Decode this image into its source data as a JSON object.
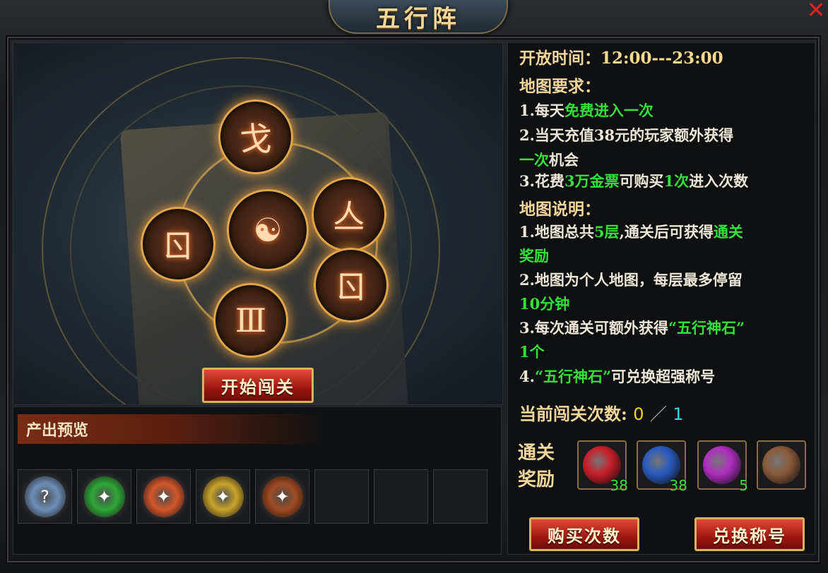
{
  "window": {
    "title": "五行阵",
    "close_symbol": "✕"
  },
  "scene": {
    "runes": [
      "戈",
      "亼",
      "ㄖ",
      "ㄖ",
      "Ⅲ"
    ],
    "center_symbol": "☯",
    "start_button": "开始闯关"
  },
  "preview": {
    "header": "产出预览",
    "items": [
      {
        "icon": "blue-gem-icon",
        "color": "#6f8fb8",
        "glyph": "?"
      },
      {
        "icon": "green-gem-icon",
        "color": "#2fa838",
        "glyph": "✦"
      },
      {
        "icon": "orange-gem-icon",
        "color": "#d3562a",
        "glyph": "✦"
      },
      {
        "icon": "gold-gem-icon",
        "color": "#c9a42a",
        "glyph": "✦"
      },
      {
        "icon": "bronze-gem-icon",
        "color": "#a24a22",
        "glyph": "✦"
      }
    ],
    "empty_slots": 3
  },
  "info": {
    "open_time_label": "开放时间：",
    "open_time_value": "12:00---23:00",
    "map_req_title": "地图要求：",
    "req1_a": "1.每天",
    "req1_b": "免费进入一次",
    "req2_a": "2.当天充值38元的玩家额外获得",
    "req2_b": "一次",
    "req2_c": "机会",
    "req3_a": "3.花费",
    "req3_b": "3万金票",
    "req3_c": "可购买",
    "req3_d": "1次",
    "req3_e": "进入次数",
    "map_desc_title": "地图说明：",
    "desc1_a": "1.地图总共",
    "desc1_b": "5层",
    "desc1_c": ",通关后可获得",
    "desc1_d": "通关",
    "desc1_e": "奖励",
    "desc2_a": "2.地图为个人地图，每层最多停留",
    "desc2_b": "10分钟",
    "desc3_a": "3.每次通关可额外获得",
    "desc3_b": "“五行神石”",
    "desc3_c": "1个",
    "desc4_a": "4.",
    "desc4_b": "“五行神石”",
    "desc4_c": "可兑换超强称号",
    "counter_label": "当前闯关次数:",
    "counter_used": "0",
    "counter_sep": "／",
    "counter_total": "1",
    "rewards_label": "通关奖励",
    "rewards": [
      {
        "icon": "red-orb-icon",
        "color": "#c81e2a",
        "count": "38"
      },
      {
        "icon": "blue-orb-icon",
        "color": "#2a5ac0",
        "count": "38"
      },
      {
        "icon": "purple-orb-icon",
        "color": "#b02ec0",
        "count": "5"
      },
      {
        "icon": "eye-orb-icon",
        "color": "#8a5a3a",
        "count": ""
      }
    ],
    "buy_button": "购买次数",
    "exchange_button": "兑换称号"
  }
}
